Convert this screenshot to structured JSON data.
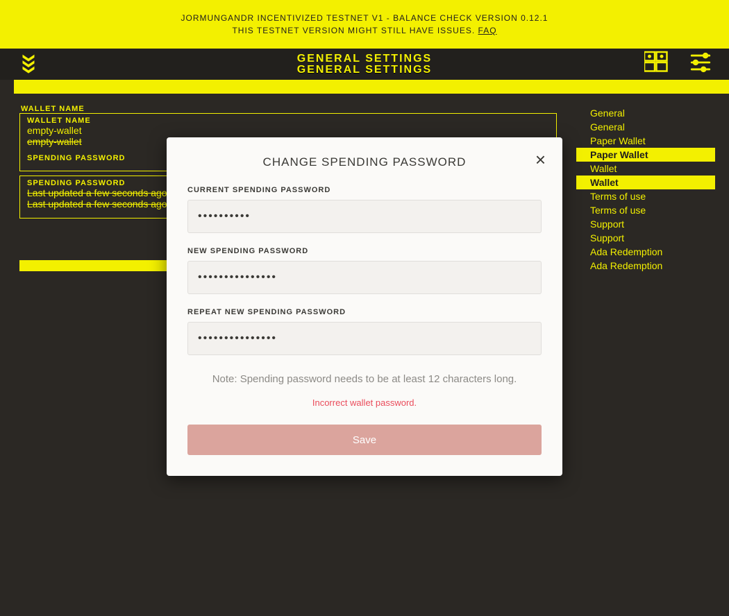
{
  "banner": {
    "line1": "JORMUNGANDR INCENTIVIZED TESTNET V1 - BALANCE CHECK VERSION 0.12.1",
    "line2_prefix": "THIS TESTNET VERSION MIGHT STILL HAVE ISSUES. ",
    "faq_label": "FAQ"
  },
  "header": {
    "title": "GENERAL SETTINGS"
  },
  "wallet": {
    "name_label": "WALLET NAME",
    "name_value": "empty-wallet",
    "name_value_struck": "empty-wallet",
    "spending_label": "SPENDING PASSWORD",
    "spending_value": "Last updated a few seconds ago",
    "spending_value_struck": "Last updated a few seconds ago"
  },
  "sidebar": {
    "items": [
      {
        "label": "General",
        "selected": false
      },
      {
        "label": "General",
        "selected": false
      },
      {
        "label": "Paper Wallet",
        "selected": false
      },
      {
        "label": "Paper Wallet",
        "selected": true
      },
      {
        "label": "Wallet",
        "selected": false
      },
      {
        "label": "Wallet",
        "selected": true
      },
      {
        "label": "Terms of use",
        "selected": false
      },
      {
        "label": "Terms of use",
        "selected": false
      },
      {
        "label": "Support",
        "selected": false
      },
      {
        "label": "Support",
        "selected": false
      },
      {
        "label": "Ada Redemption",
        "selected": false
      },
      {
        "label": "Ada Redemption",
        "selected": false
      }
    ]
  },
  "modal": {
    "title": "CHANGE SPENDING PASSWORD",
    "close_glyph": "×",
    "fields": {
      "current": {
        "label": "CURRENT SPENDING PASSWORD",
        "value": "Secret_123"
      },
      "new": {
        "label": "NEW SPENDING PASSWORD",
        "value": "newSecret123456"
      },
      "repeat": {
        "label": "REPEAT NEW SPENDING PASSWORD",
        "value": "newSecret123456"
      }
    },
    "note": "Note: Spending password needs to be at least 12 characters long.",
    "error": "Incorrect wallet password.",
    "save_label": "Save"
  },
  "icons": {
    "chevrons": "chevrons-down-icon",
    "dashboard": "dashboard-icon",
    "settings": "sliders-icon"
  }
}
